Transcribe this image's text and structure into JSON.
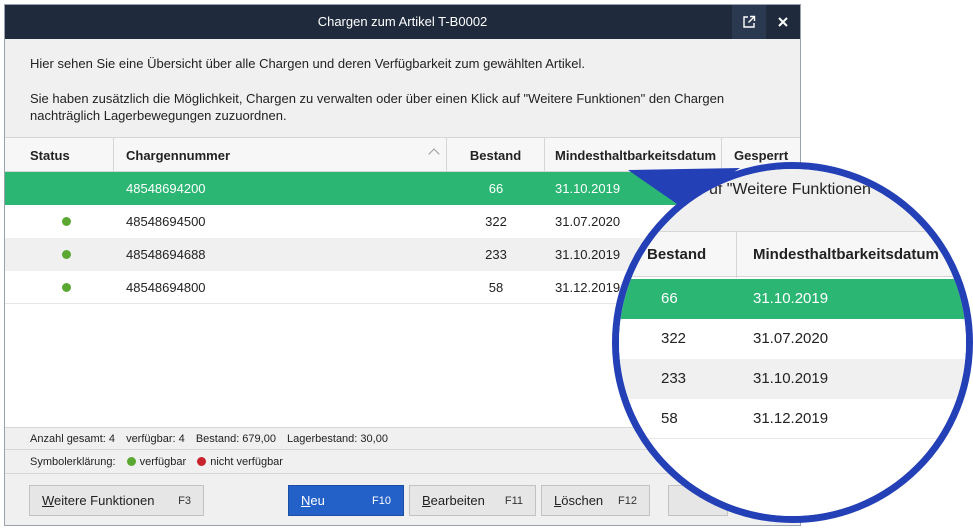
{
  "window": {
    "title": "Chargen zum Artikel T-B0002",
    "popout_icon": "external-link-icon",
    "close_icon": "close-icon"
  },
  "intro": {
    "line1": "Hier sehen Sie eine Übersicht über alle Chargen und deren Verfügbarkeit zum gewählten Artikel.",
    "line2": "Sie haben zusätzlich die Möglichkeit, Chargen zu verwalten oder über einen Klick auf \"Weitere Funktionen\" den Chargen nachträglich Lagerbewegungen zuzuordnen."
  },
  "table": {
    "columns": [
      "Status",
      "Chargennummer",
      "Bestand",
      "Mindesthaltbarkeitsdatum",
      "Gesperrt"
    ],
    "rows": [
      {
        "status": "verfügbar",
        "nummer": "48548694200",
        "bestand": "66",
        "mhd": "31.10.2019",
        "selected": true
      },
      {
        "status": "verfügbar",
        "nummer": "48548694500",
        "bestand": "322",
        "mhd": "31.07.2020",
        "selected": false
      },
      {
        "status": "verfügbar",
        "nummer": "48548694688",
        "bestand": "233",
        "mhd": "31.10.2019",
        "selected": false
      },
      {
        "status": "verfügbar",
        "nummer": "48548694800",
        "bestand": "58",
        "mhd": "31.12.2019",
        "selected": false
      }
    ]
  },
  "summary": {
    "gesamt": "Anzahl gesamt: 4",
    "verfuegbar": "verfügbar: 4",
    "bestand": "Bestand: 679,00",
    "lagerbestand": "Lagerbestand: 30,00"
  },
  "legend": {
    "label": "Symbolerklärung:",
    "available": "verfügbar",
    "unavailable": "nicht verfügbar"
  },
  "buttons": {
    "more": {
      "label_u": "W",
      "label_rest": "eitere Funktionen",
      "key": "F3"
    },
    "neu": {
      "label_u": "N",
      "label_rest": "eu",
      "key": "F10"
    },
    "edit": {
      "label_u": "B",
      "label_rest": "earbeiten",
      "key": "F11"
    },
    "delete": {
      "label_u": "L",
      "label_rest": "öschen",
      "key": "F12"
    }
  },
  "magnifier": {
    "intro_fragment": "uf \"Weitere Funktionen",
    "columns": [
      "Bestand",
      "Mindesthaltbarkeitsdatum"
    ]
  },
  "colors": {
    "titlebar": "#1f2b3d",
    "selected_row": "#2bb673",
    "primary_button": "#2360c8",
    "status_available": "#5aa832",
    "status_unavailable": "#c8232c",
    "magnifier_ring": "#2440b7"
  }
}
